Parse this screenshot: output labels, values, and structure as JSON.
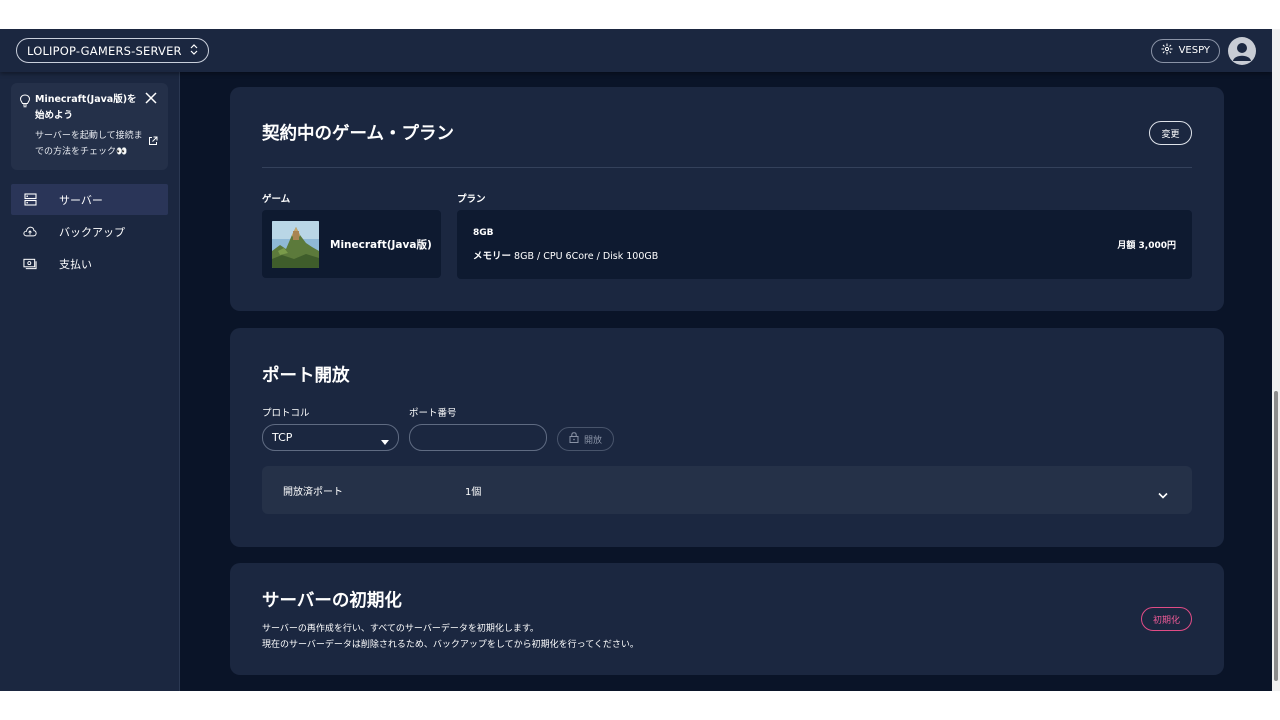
{
  "topbar": {
    "server_name": "LOLIPOP-GAMERS-SERVER",
    "user_name": "VESPY"
  },
  "sidebar": {
    "tip": {
      "title": "Minecraft(Java版)を始めよう",
      "text": "サーバーを起動して接続までの方法をチェック👀"
    },
    "items": [
      {
        "label": "サーバー",
        "icon": "server-icon",
        "active": true
      },
      {
        "label": "バックアップ",
        "icon": "cloud-upload-icon",
        "active": false
      },
      {
        "label": "支払い",
        "icon": "payment-icon",
        "active": false
      }
    ]
  },
  "contract": {
    "title": "契約中のゲーム・プラン",
    "change_label": "変更",
    "game_label": "ゲーム",
    "plan_label": "プラン",
    "game_name": "Minecraft(Java版)",
    "plan_name": "8GB",
    "spec_prefix": "メモリー",
    "spec": "8GB / CPU 6Core / Disk 100GB",
    "price": "月額 3,000円"
  },
  "ports": {
    "title": "ポート開放",
    "protocol_label": "プロトコル",
    "port_label": "ポート番号",
    "protocol_value": "TCP",
    "port_value": "",
    "open_label": "開放",
    "opened_label": "開放済ポート",
    "opened_count": "1個"
  },
  "reset": {
    "title": "サーバーの初期化",
    "desc1": "サーバーの再作成を行い、すべてのサーバーデータを初期化します。",
    "desc2": "現在のサーバーデータは削除されるため、バックアップをしてから初期化を行ってください。",
    "button_label": "初期化"
  },
  "colors": {
    "background": "#0a1428",
    "panel": "#1b2740",
    "danger": "#ef5b97"
  }
}
